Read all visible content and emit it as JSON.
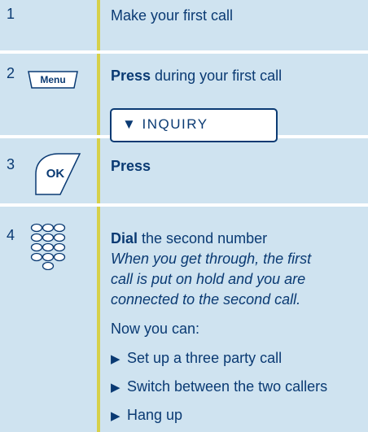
{
  "steps": [
    {
      "number": "1",
      "text": "Make your first call"
    },
    {
      "number": "2",
      "key_label": "Menu",
      "bold": "Press",
      "text": " during your first call",
      "display": "▼ INQUIRY"
    },
    {
      "number": "3",
      "key_label": "OK",
      "bold": "Press"
    },
    {
      "number": "4",
      "bold": "Dial",
      "text": " the second number",
      "italic_lines": [
        "When you get through, the first",
        "call is put on hold and you are",
        "connected to the second call."
      ],
      "now_label": "Now you can:",
      "bullets": [
        "Set up a three party call",
        "Switch between the two callers",
        "Hang up"
      ]
    }
  ],
  "bullet_glyph": "▶",
  "icons": {
    "menu": "menu-key-icon",
    "ok": "ok-key-icon",
    "keypad": "keypad-icon"
  },
  "colors": {
    "background": "#cfe3f0",
    "text": "#0a3a73",
    "divider": "#d6d04a"
  }
}
